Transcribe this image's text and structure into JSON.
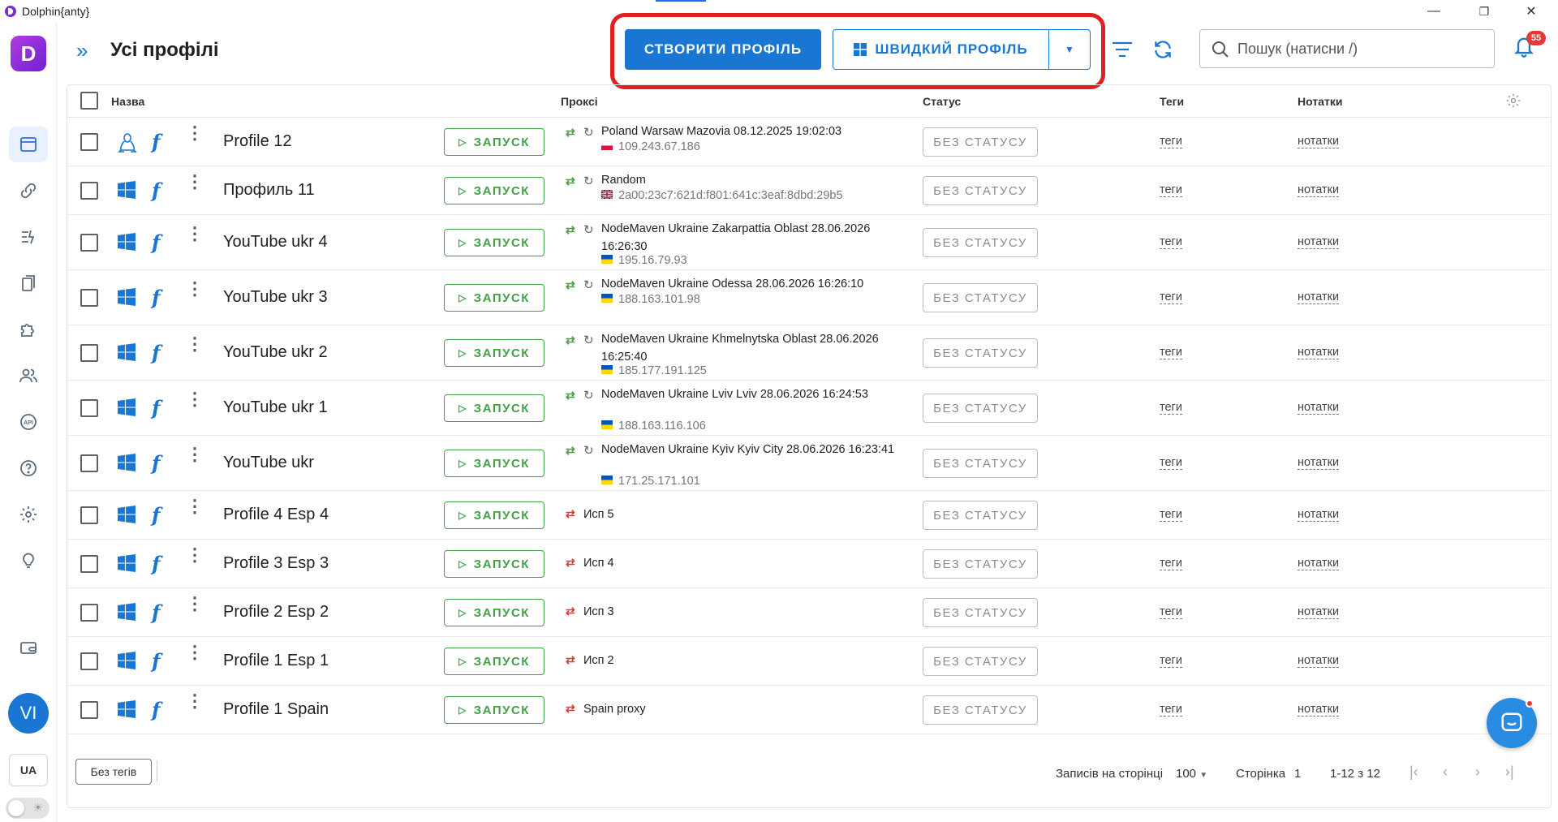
{
  "window": {
    "title": "Dolphin{anty}",
    "controls": {
      "minimize": "—",
      "restore": "❐",
      "close": "✕"
    }
  },
  "sidebar": {
    "brand": "D",
    "items": [
      {
        "name": "profiles",
        "icon": "browser-window-icon",
        "active": true
      },
      {
        "name": "proxies",
        "icon": "link-icon",
        "active": false
      },
      {
        "name": "scenarios",
        "icon": "automation-icon",
        "active": false
      },
      {
        "name": "bookmarks",
        "icon": "bookmark-icon",
        "active": false
      },
      {
        "name": "extensions",
        "icon": "puzzle-icon",
        "active": false
      },
      {
        "name": "team",
        "icon": "users-icon",
        "active": false
      },
      {
        "name": "api",
        "icon": "api-icon",
        "active": false
      },
      {
        "name": "help",
        "icon": "help-icon",
        "active": false
      },
      {
        "name": "settings",
        "icon": "gear-icon",
        "active": false
      },
      {
        "name": "tips",
        "icon": "lightbulb-icon",
        "active": false
      },
      {
        "name": "wallet",
        "icon": "wallet-icon",
        "active": false
      }
    ],
    "avatar": "VI",
    "language": "UA"
  },
  "header": {
    "title": "Усі профілі",
    "create_label": "СТВОРИТИ ПРОФІЛЬ",
    "quick_label": "ШВИДКИЙ ПРОФІЛЬ",
    "search_placeholder": "Пошук (натисни /)",
    "notifications_count": "55"
  },
  "table": {
    "columns": {
      "name": "Назва",
      "proxy": "Проксі",
      "status": "Статус",
      "tags": "Теги",
      "notes": "Нотатки"
    },
    "run_label": "ЗАПУСК",
    "status_label": "БЕЗ СТАТУСУ",
    "tags_label": "теги",
    "notes_label": "нотатки",
    "rows": [
      {
        "name": "Profile 12",
        "os": "linux",
        "proxy_type": "sync",
        "proxy_name": "Poland Warsaw Mazovia 08.12.2025 19:02:03",
        "proxy_ip": "109.243.67.186",
        "flag": "pl"
      },
      {
        "name": "Профиль 11",
        "os": "windows",
        "proxy_type": "sync",
        "proxy_name": "Random",
        "proxy_ip": "2a00:23c7:621d:f801:641c:3eaf:8dbd:29b5",
        "flag": "gb"
      },
      {
        "name": "YouTube ukr 4",
        "os": "windows",
        "proxy_type": "sync",
        "proxy_name": "NodeMaven Ukraine Zakarpattia Oblast 28.06.2026 16:26:30",
        "proxy_ip": "195.16.79.93",
        "flag": "ua"
      },
      {
        "name": "YouTube ukr 3",
        "os": "windows",
        "proxy_type": "sync",
        "proxy_name": "NodeMaven Ukraine Odessa 28.06.2026 16:26:10",
        "proxy_ip": "188.163.101.98",
        "flag": "ua"
      },
      {
        "name": "YouTube ukr 2",
        "os": "windows",
        "proxy_type": "sync",
        "proxy_name": "NodeMaven Ukraine Khmelnytska Oblast 28.06.2026 16:25:40",
        "proxy_ip": "185.177.191.125",
        "flag": "ua"
      },
      {
        "name": "YouTube ukr 1",
        "os": "windows",
        "proxy_type": "sync",
        "proxy_name": "NodeMaven Ukraine Lviv Lviv 28.06.2026 16:24:53",
        "proxy_ip": "188.163.116.106",
        "flag": "ua"
      },
      {
        "name": "YouTube ukr",
        "os": "windows",
        "proxy_type": "sync",
        "proxy_name": "NodeMaven Ukraine Kyiv Kyiv City 28.06.2026 16:23:41",
        "proxy_ip": "171.25.171.101",
        "flag": "ua"
      },
      {
        "name": "Profile 4 Esp 4",
        "os": "windows",
        "proxy_type": "error",
        "proxy_name": "Исп 5",
        "proxy_ip": "",
        "flag": ""
      },
      {
        "name": "Profile 3 Esp 3",
        "os": "windows",
        "proxy_type": "error",
        "proxy_name": "Исп 4",
        "proxy_ip": "",
        "flag": ""
      },
      {
        "name": "Profile 2 Esp 2",
        "os": "windows",
        "proxy_type": "error",
        "proxy_name": "Исп 3",
        "proxy_ip": "",
        "flag": ""
      },
      {
        "name": "Profile 1 Esp 1",
        "os": "windows",
        "proxy_type": "error",
        "proxy_name": "Исп 2",
        "proxy_ip": "",
        "flag": ""
      },
      {
        "name": "Profile 1 Spain",
        "os": "windows",
        "proxy_type": "error",
        "proxy_name": "Spain proxy",
        "proxy_ip": "",
        "flag": ""
      }
    ]
  },
  "footer": {
    "no_tags_label": "Без тегів",
    "rows_per_page_label": "Записів на сторінці",
    "rows_per_page_value": "100",
    "page_label": "Сторінка",
    "page_value": "1",
    "range_label": "1-12 з 12"
  },
  "colors": {
    "primary": "#1976d2",
    "run_green": "#43a047",
    "proxy_ok": "#43a047",
    "proxy_error": "#e53935",
    "highlight": "#e02020"
  }
}
